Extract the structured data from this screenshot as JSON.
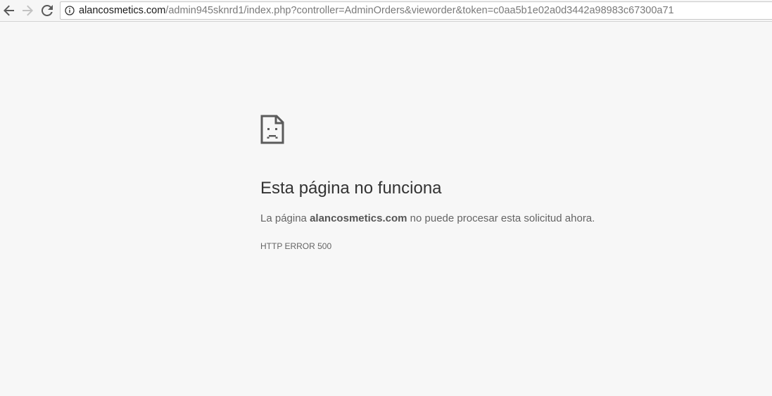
{
  "browser": {
    "back_icon": "arrow-left-icon",
    "forward_icon": "arrow-right-icon",
    "reload_icon": "reload-icon",
    "site_info_icon": "info-circle-icon",
    "url_host": "alancosmetics.com",
    "url_path": "/admin945sknrd1/index.php?controller=AdminOrders&vieworder&token=c0aa5b1e02a0d3442a98983c67300a71"
  },
  "error_page": {
    "icon": "sad-page-icon",
    "title": "Esta página no funciona",
    "description_prefix": "La página ",
    "description_host": "alancosmetics.com",
    "description_suffix": " no puede procesar esta solicitud ahora.",
    "error_code": "HTTP ERROR 500"
  },
  "colors": {
    "page_background": "#f7f7f7",
    "title_text": "#333333",
    "body_text": "#646464"
  }
}
